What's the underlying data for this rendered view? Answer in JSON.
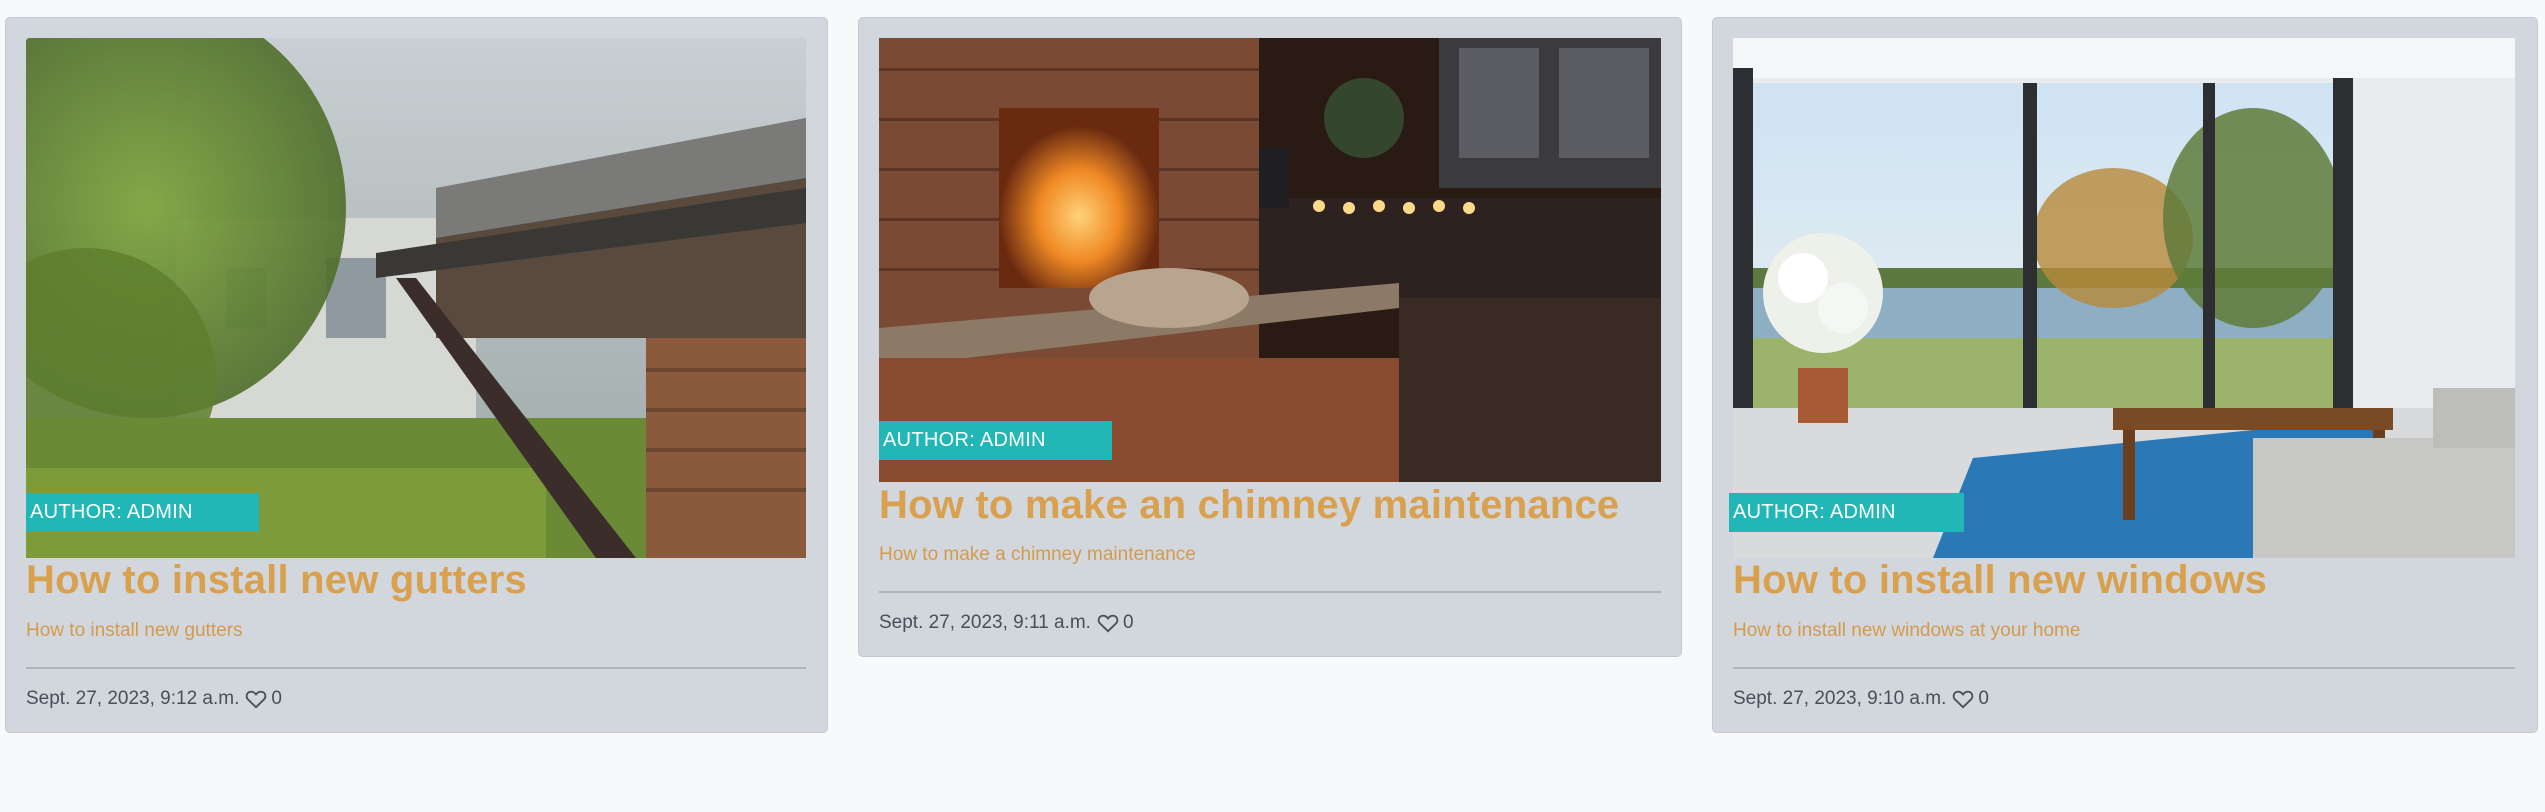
{
  "posts": [
    {
      "author": "AUTHOR: ADMIN",
      "title": "How to install new gutters",
      "subtitle": "How to install new gutters",
      "date": "Sept. 27, 2023, 9:12 a.m.",
      "likes": "0",
      "image": "gutter-photo"
    },
    {
      "author": "AUTHOR: ADMIN",
      "title": "How to make an chimney maintenance",
      "subtitle": "How to make a chimney maintenance",
      "date": "Sept. 27, 2023, 9:11 a.m.",
      "likes": "0",
      "image": "fireplace-photo"
    },
    {
      "author": "AUTHOR: ADMIN",
      "title": "How to install new windows",
      "subtitle": "How to install new windows at your home",
      "date": "Sept. 27, 2023, 9:10 a.m.",
      "likes": "0",
      "image": "living-room-photo"
    }
  ],
  "colors": {
    "card_bg": "#d2d7de",
    "badge": "#22b7b7",
    "title": "#d9a04e",
    "meta": "#4a4f57"
  }
}
